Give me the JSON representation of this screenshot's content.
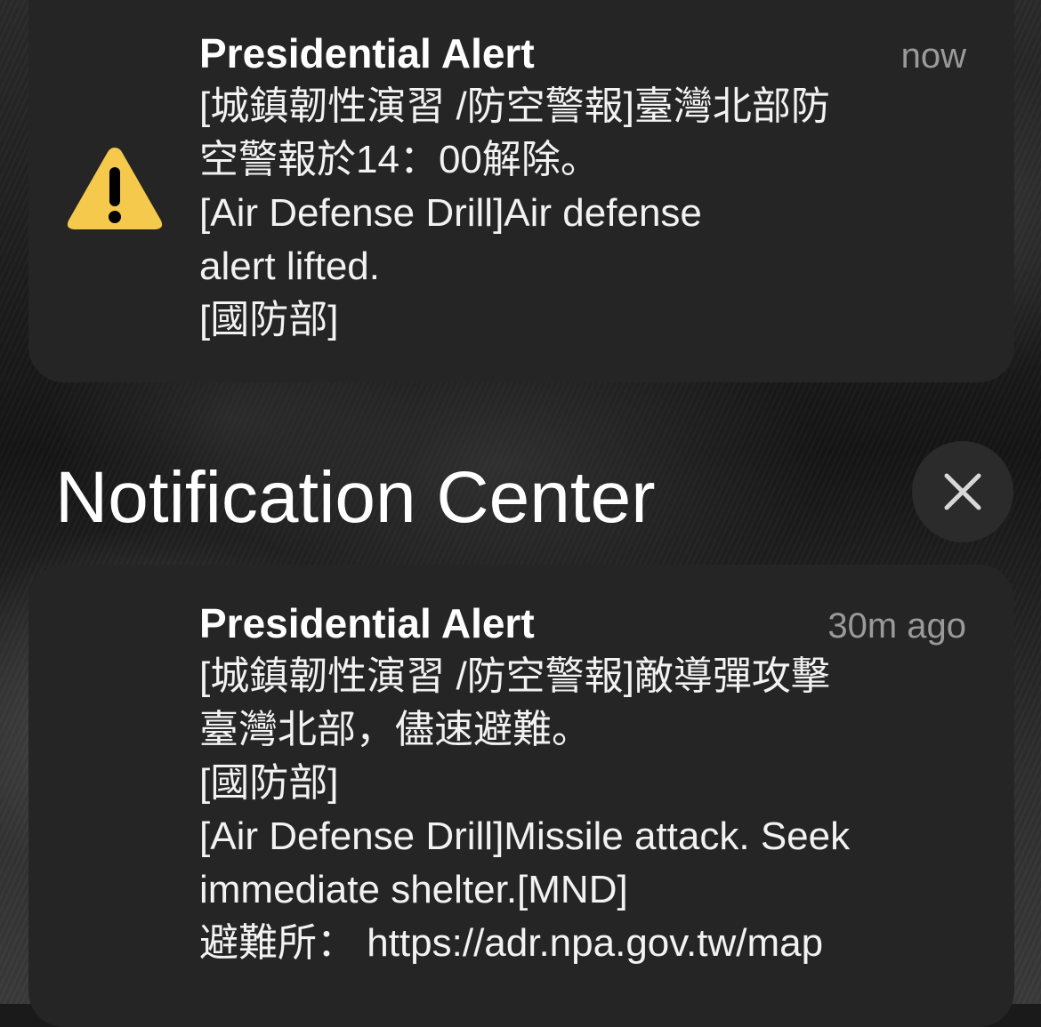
{
  "notifications": [
    {
      "app_name": "Presidential Alert",
      "time": "now",
      "icon": "warning-triangle-icon",
      "icon_color": "#F5C94B",
      "lines": [
        "[城鎮韌性演習 /防空警報]臺灣北部防",
        "空警報於14：00解除。",
        "[Air Defense Drill]Air defense",
        "alert lifted.",
        "[國防部]"
      ]
    },
    {
      "app_name": "Presidential Alert",
      "time": "30m ago",
      "lines": [
        "[城鎮韌性演習 /防空警報]敵導彈攻擊",
        "臺灣北部，儘速避難。",
        "[國防部]",
        "[Air Defense Drill]Missile attack. Seek",
        "immediate shelter.[MND]",
        "避難所：  https://adr.npa.gov.tw/map"
      ]
    }
  ],
  "notification_center": {
    "title": "Notification Center",
    "close_icon": "close-icon"
  },
  "colors": {
    "card_background": "#252525",
    "secondary_text": "#9a9a9a"
  }
}
